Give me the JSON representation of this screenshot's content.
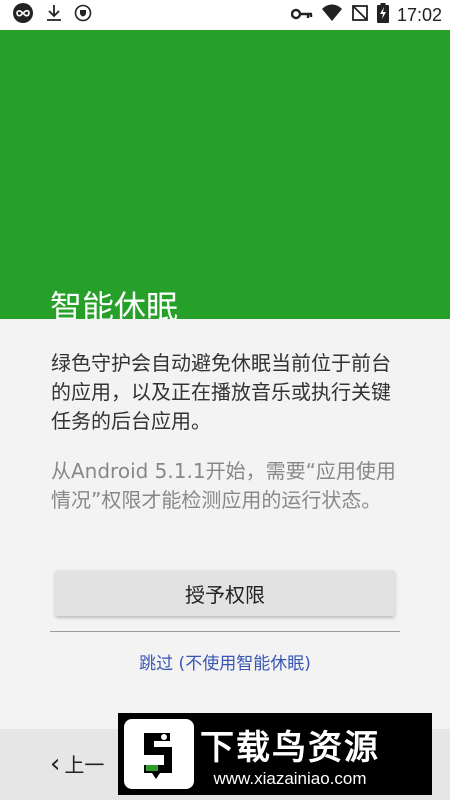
{
  "status_bar": {
    "time": "17:02",
    "icons_left": [
      "infinity-icon",
      "download-icon",
      "shield-icon"
    ],
    "icons_right": [
      "key-icon",
      "wifi-icon",
      "no-sim-icon",
      "battery-charging-icon"
    ]
  },
  "header": {
    "title": "智能休眠",
    "background_color": "#27a02a"
  },
  "content": {
    "description": "绿色守护会自动避免休眠当前位于前台的应用，以及正在播放音乐或执行关键任务的后台应用。",
    "note": "从Android 5.1.1开始，需要“应用使用情况”权限才能检测应用的运行状态。",
    "grant_button": "授予权限",
    "skip_link": "跳过 (不使用智能休眠)"
  },
  "bottom_bar": {
    "back_label": "上一"
  },
  "watermark": {
    "title": "下载鸟资源",
    "url": "www.xiazainiao.com"
  }
}
